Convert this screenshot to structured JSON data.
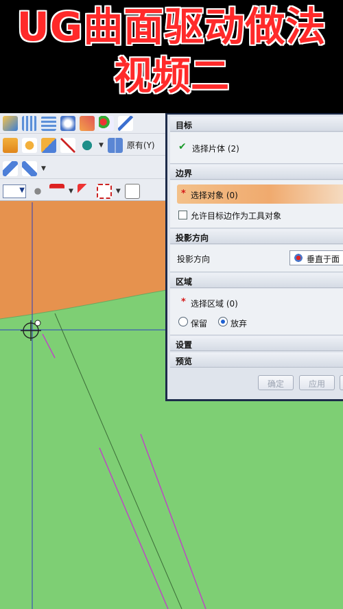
{
  "banner": {
    "line1": "UG曲面驱动做法",
    "line2": "视频二"
  },
  "toolbar": {
    "original_label": "原有(Y)",
    "icons": [
      "surface-icon",
      "mesh-surface-icon",
      "grid-surface-icon",
      "swept-icon",
      "blend-icon",
      "snap-icon",
      "curve-icon",
      "cube-array-icon",
      "boolean-icon",
      "coord-icon",
      "paint-icon",
      "book-icon",
      "shape-icon",
      "pointer-icon",
      "filter-icon",
      "select-box-icon",
      "view-icon"
    ]
  },
  "dialog": {
    "target": {
      "header": "目标",
      "select_sheet": "选择片体 (2)"
    },
    "boundary": {
      "header": "边界",
      "select_object": "选择对象 (0)",
      "allow_target_edge": "允许目标边作为工具对象"
    },
    "projection": {
      "header": "投影方向",
      "label": "投影方向",
      "value": "垂直于面"
    },
    "region": {
      "header": "区域",
      "select_region": "选择区域 (0)",
      "keep": "保留",
      "discard": "放弃"
    },
    "settings": {
      "header": "设置"
    },
    "preview": {
      "header": "预览"
    },
    "buttons": {
      "ok": "确定",
      "apply": "应用"
    }
  },
  "colors": {
    "title_red": "#ff2a2a",
    "surface_orange": "#e6924e",
    "surface_green": "#7ecf74",
    "axis_blue": "#2b3fbf",
    "curve_magenta": "#c040c8"
  }
}
